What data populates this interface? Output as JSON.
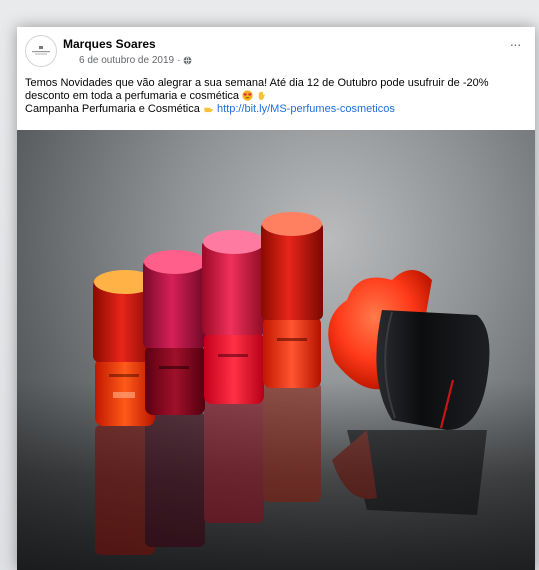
{
  "post": {
    "author": "Marques Soares",
    "date": "6 de outubro de 2019",
    "separator": "·",
    "more_label": "···",
    "text_line1": "Temos Novidades que vão alegrar a sua semana! Até dia 12 de Outubro pode usufruir de -20%",
    "text_line2": "desconto em toda a perfumaria e cosmética",
    "text_line3": "Campanha Perfumaria e Cosmética",
    "link": "http://bit.ly/MS-perfumes-cosmeticos",
    "emojis": [
      "heart-eyes-emoji",
      "waving-hand-emoji",
      "pointing-hand-emoji"
    ],
    "privacy_icon": "globe-icon"
  },
  "photo": {
    "subject": "product-photo",
    "bottle_colors": [
      "#ffb347",
      "#ff5f8a",
      "#ff7aa0",
      "#ff8060"
    ],
    "brush_bristle_color": "#ff3b1f",
    "brush_handle_color": "#0f1012"
  }
}
